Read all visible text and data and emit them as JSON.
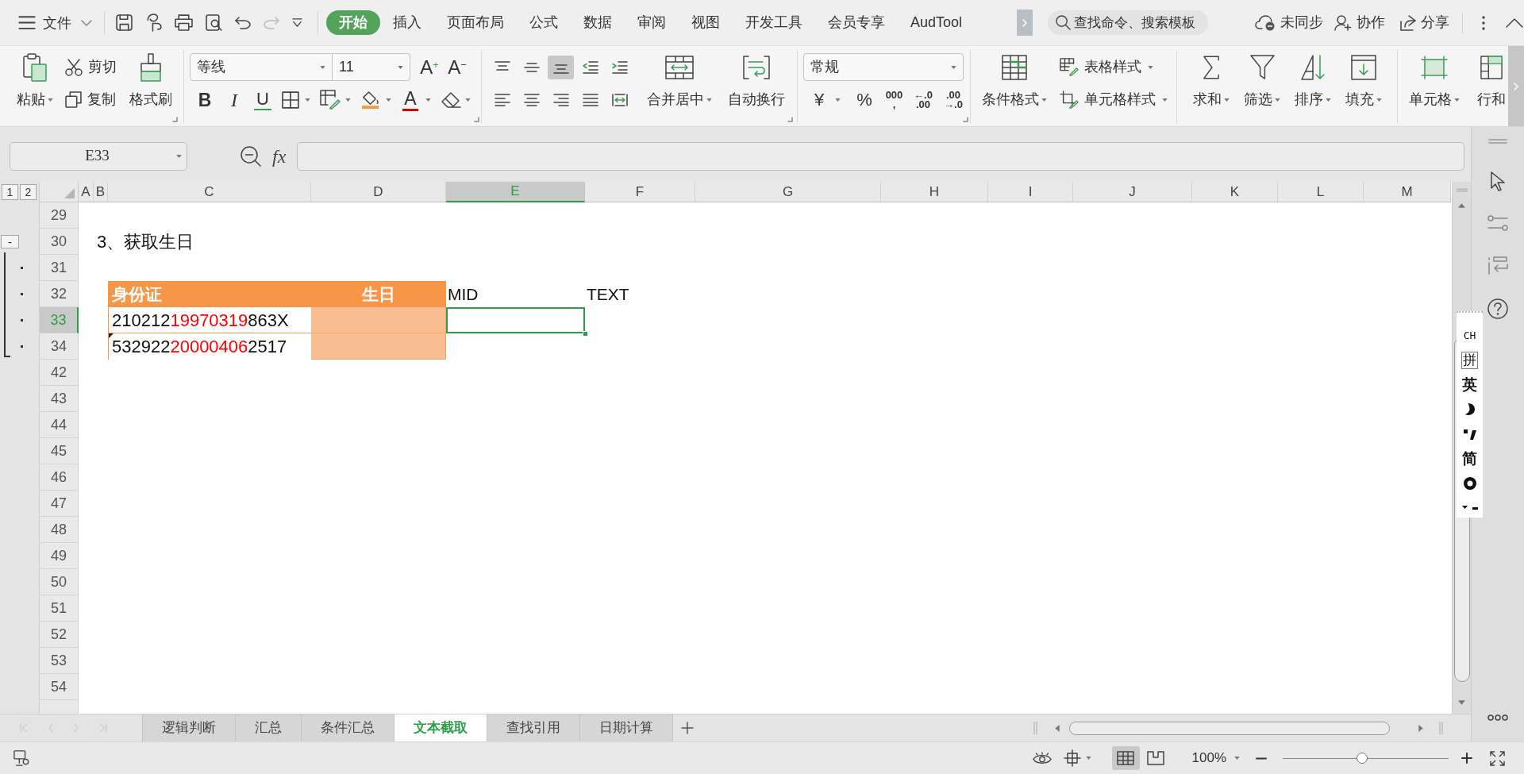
{
  "top_bar": {
    "file_menu": "文件",
    "tabs": [
      {
        "label": "开始",
        "selected": true
      },
      {
        "label": "插入",
        "selected": false
      },
      {
        "label": "页面布局",
        "selected": false
      },
      {
        "label": "公式",
        "selected": false
      },
      {
        "label": "数据",
        "selected": false
      },
      {
        "label": "审阅",
        "selected": false
      },
      {
        "label": "视图",
        "selected": false
      },
      {
        "label": "开发工具",
        "selected": false
      },
      {
        "label": "会员专享",
        "selected": false
      },
      {
        "label": "AudTool",
        "selected": false
      }
    ],
    "search": {
      "placeholder": "查找命令、搜索模板"
    },
    "actions": [
      {
        "kind": "sync",
        "label": "未同步"
      },
      {
        "kind": "collaborate",
        "label": "协作"
      },
      {
        "kind": "share",
        "label": "分享"
      }
    ]
  },
  "ribbon": {
    "clipboard": {
      "paste": "粘贴",
      "cut": "剪切",
      "copy": "复制",
      "format_painter": "格式刷"
    },
    "font": {
      "name": "等线",
      "size": "11",
      "grow": "A$^{+}$",
      "shrink": "A$^{−}$",
      "styles": [
        {
          "kind": "bold",
          "glyph": "B"
        },
        {
          "kind": "italic",
          "glyph": "I"
        },
        {
          "kind": "underline",
          "glyph": "U"
        }
      ],
      "font_color": "A"
    },
    "alignment": {
      "buttons": [
        {
          "kind": "top",
          "selected": false
        },
        {
          "kind": "middle",
          "selected": false
        },
        {
          "kind": "bottom",
          "selected": true
        },
        {
          "kind": "outdent",
          "selected": false
        },
        {
          "kind": "indent",
          "selected": false
        },
        {
          "kind": "left",
          "selected": false
        },
        {
          "kind": "center",
          "selected": false
        },
        {
          "kind": "right",
          "selected": false
        },
        {
          "kind": "justify",
          "selected": false
        },
        {
          "kind": "distributed",
          "selected": false
        }
      ],
      "merge": "合并居中",
      "wrap": "自动换行"
    },
    "number": {
      "format": "常规",
      "currency": "¥",
      "percent": "%",
      "thousands": [
        "000",
        ","
      ],
      "increase_decimal": [
        "←.0",
        ".00"
      ],
      "decrease_decimal": [
        ".00",
        "→.0"
      ]
    },
    "styles": {
      "conditional": "条件格式",
      "table_style": "表格样式",
      "cell_style": "单元格样式"
    },
    "editing": [
      {
        "kind": "sum",
        "label": "求和"
      },
      {
        "kind": "filter",
        "label": "筛选"
      },
      {
        "kind": "sort",
        "label": "排序"
      },
      {
        "kind": "fill",
        "label": "填充"
      }
    ],
    "cells": [
      {
        "kind": "cells",
        "label": "单元格"
      },
      {
        "kind": "rowcol",
        "label": "行和"
      }
    ]
  },
  "formula_bar": {
    "name_box": "E33",
    "function_label": "fx"
  },
  "sheet": {
    "outline_levels": [
      "1",
      "2"
    ],
    "columns": [
      {
        "label": "A",
        "selected": false
      },
      {
        "label": "B",
        "selected": false
      },
      {
        "label": "C",
        "selected": false
      },
      {
        "label": "D",
        "selected": false
      },
      {
        "label": "E",
        "selected": true
      },
      {
        "label": "F",
        "selected": false
      },
      {
        "label": "G",
        "selected": false
      },
      {
        "label": "H",
        "selected": false
      },
      {
        "label": "I",
        "selected": false
      },
      {
        "label": "J",
        "selected": false
      },
      {
        "label": "K",
        "selected": false
      },
      {
        "label": "L",
        "selected": false
      },
      {
        "label": "M",
        "selected": false
      }
    ],
    "rows": [
      {
        "number": "29",
        "selected": false
      },
      {
        "number": "30",
        "selected": false,
        "outline_toggle": "-",
        "title": "3、获取生日",
        "children": [
          {
            "number": "31",
            "selected": false
          },
          {
            "number": "32",
            "selected": false,
            "header": [
              "身份证",
              "生日"
            ],
            "notes": [
              "MID",
              "TEXT"
            ]
          },
          {
            "number": "33",
            "selected": true,
            "id_number": {
              "flagged": false,
              "segments": [
                {
                  "text": "210212",
                  "highlighted": false
                },
                {
                  "text": "19970319",
                  "highlighted": true
                },
                {
                  "text": "863X",
                  "highlighted": false
                }
              ]
            }
          },
          {
            "number": "34",
            "selected": false,
            "id_number": {
              "flagged": true,
              "segments": [
                {
                  "text": "532922",
                  "highlighted": false
                },
                {
                  "text": "20000406",
                  "highlighted": true
                },
                {
                  "text": "2517",
                  "highlighted": false
                }
              ]
            }
          }
        ]
      },
      {
        "number": "42",
        "selected": false
      },
      {
        "number": "43",
        "selected": false
      },
      {
        "number": "44",
        "selected": false
      },
      {
        "number": "45",
        "selected": false
      },
      {
        "number": "46",
        "selected": false
      },
      {
        "number": "47",
        "selected": false
      },
      {
        "number": "48",
        "selected": false
      },
      {
        "number": "49",
        "selected": false
      },
      {
        "number": "50",
        "selected": false
      },
      {
        "number": "51",
        "selected": false
      },
      {
        "number": "52",
        "selected": false
      },
      {
        "number": "53",
        "selected": false
      },
      {
        "number": "54",
        "selected": false
      }
    ]
  },
  "sheet_tabs": [
    {
      "label": "逻辑判断",
      "selected": false
    },
    {
      "label": "汇总",
      "selected": false
    },
    {
      "label": "条件汇总",
      "selected": false
    },
    {
      "label": "文本截取",
      "selected": true
    },
    {
      "label": "查找引用",
      "selected": false
    },
    {
      "label": "日期计算",
      "selected": false
    }
  ],
  "status_bar": {
    "views": [
      {
        "kind": "normal",
        "selected": true
      },
      {
        "kind": "page",
        "selected": false
      }
    ],
    "zoom": "100%",
    "zoom_slider": {
      "level": 0.48
    }
  },
  "ime_toolbar": [
    {
      "kind": "label",
      "text": "CH"
    },
    {
      "kind": "boxed",
      "text": "拼"
    },
    {
      "kind": "text",
      "text": "英"
    },
    {
      "kind": "moon"
    },
    {
      "kind": "punctuation"
    },
    {
      "kind": "text",
      "text": "简"
    },
    {
      "kind": "gear"
    },
    {
      "kind": "menu"
    }
  ]
}
